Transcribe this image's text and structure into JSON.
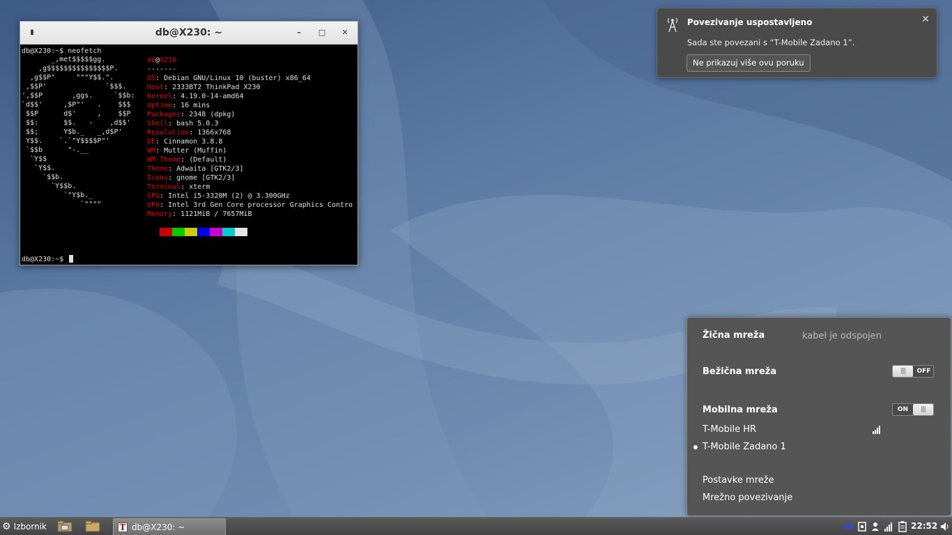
{
  "terminal": {
    "title": "db@X230: ~",
    "prompt_cmd": "db@X230:~$ neofetch",
    "prompt_end": "db@X230:~$ ",
    "ascii_logo": [
      "       _,met$$$$$gg.",
      "    ,g$$$$$$$$$$$$$$$P.",
      "  ,g$$P\"     \"\"\"Y$$.\".",
      " ,$$P'              `$$$.",
      "',$$P       ,ggs.     `$$b:",
      "`d$$'     ,$P\"'   .    $$$",
      " $$P      d$'     ,    $$P",
      " $$:      $$.   -    ,d$$'",
      " $$;      Y$b._   _,d$P'",
      " Y$$.    `.`\"Y$$$$P\"'",
      " `$$b      \"-.__",
      "  `Y$$",
      "   `Y$$.",
      "     `$$b.",
      "       `Y$$b.",
      "          `\"Y$b._",
      "              `\"\"\"\""
    ],
    "user_host": {
      "user": "db",
      "at": "@",
      "host": "X230"
    },
    "separator": "-------",
    "info": [
      {
        "key": "OS",
        "value": "Debian GNU/Linux 10 (buster) x86_64"
      },
      {
        "key": "Host",
        "value": "2333BT2 ThinkPad X230"
      },
      {
        "key": "Kernel",
        "value": "4.19.0-14-amd64"
      },
      {
        "key": "Uptime",
        "value": "16 mins"
      },
      {
        "key": "Packages",
        "value": "2348 (dpkg)"
      },
      {
        "key": "Shell",
        "value": "bash 5.0.3"
      },
      {
        "key": "Resolution",
        "value": "1366x768"
      },
      {
        "key": "DE",
        "value": "Cinnamon 3.8.8"
      },
      {
        "key": "WM",
        "value": "Mutter (Muffin)"
      },
      {
        "key": "WM Theme",
        "value": "(Default)"
      },
      {
        "key": "Theme",
        "value": "Adwaita [GTK2/3]"
      },
      {
        "key": "Icons",
        "value": "gnome [GTK2/3]"
      },
      {
        "key": "Terminal",
        "value": "xterm"
      },
      {
        "key": "CPU",
        "value": "Intel i5-3320M (2) @ 3.300GHz"
      },
      {
        "key": "GPU",
        "value": "Intel 3rd Gen Core processor Graphics Contro"
      },
      {
        "key": "Memory",
        "value": "1121MiB / 7657MiB"
      }
    ],
    "palette": [
      "#cd0000",
      "#00cd00",
      "#cdcd00",
      "#0000ee",
      "#cd00cd",
      "#00cdcd",
      "#e5e5e5"
    ]
  },
  "notification": {
    "title": "Povezivanje uspostavljeno",
    "body": "Sada ste povezani s “T-Mobile Zadano 1”.",
    "button": "Ne prikazuj više ovu poruku"
  },
  "network_menu": {
    "wired_label": "Žična mreža",
    "wired_status": "kabel je odspojen",
    "wireless_label": "Bežična mreža",
    "wireless_toggle": "OFF",
    "mobile_label": "Mobilna mreža",
    "mobile_toggle": "ON",
    "networks": [
      "T-Mobile HR",
      "T-Mobile Zadano 1"
    ],
    "settings": "Postavke mreže",
    "connections": "Mrežno povezivanje"
  },
  "taskbar": {
    "menu_label": "Izbornik",
    "task_label": "db@X230: ~",
    "clock": "22:52"
  }
}
